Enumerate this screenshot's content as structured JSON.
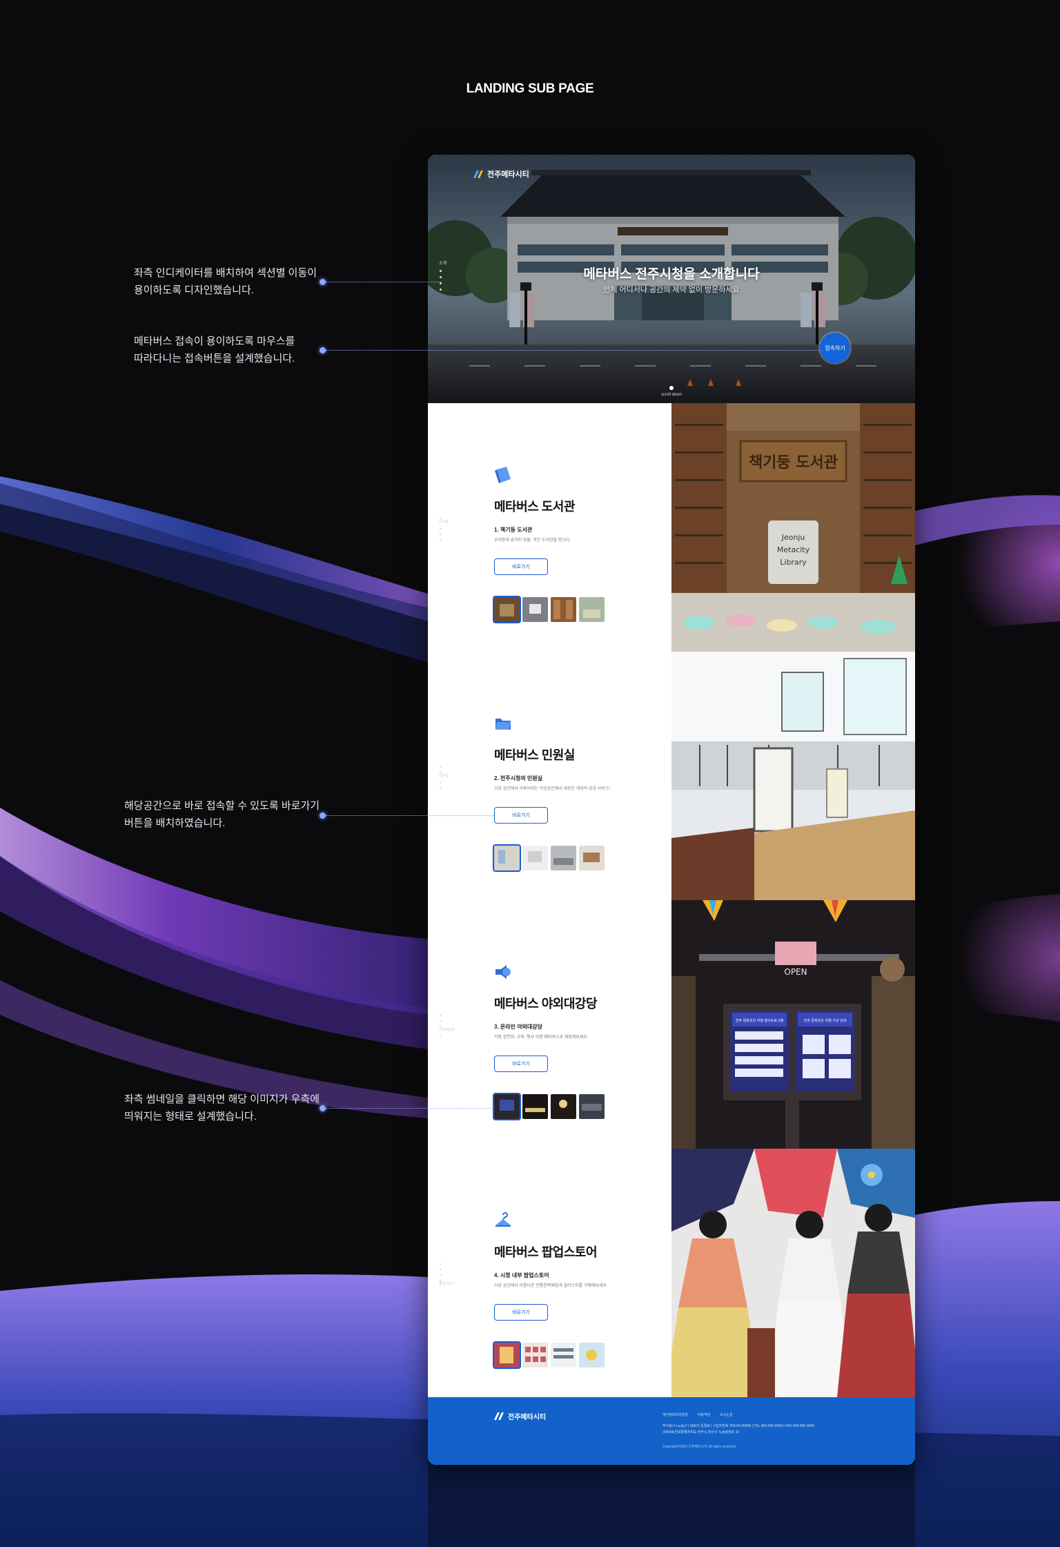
{
  "page": {
    "heading": "LANDING SUB PAGE"
  },
  "annotations": [
    {
      "lines": [
        "좌측 인디케이터를 배치하여 섹션별 이동이",
        "용이하도록 디자인했습니다."
      ]
    },
    {
      "lines": [
        "메타버스 접속이 용이하도록 마우스를",
        "따라다니는 접속버튼을 설계했습니다."
      ]
    },
    {
      "lines": [
        "해당공간으로 바로 접속할 수 있도록 바로가기",
        "버튼을 배치하였습니다."
      ]
    },
    {
      "lines": [
        "좌측 썸네일을 클릭하면 해당 이미지가 우측에",
        "띄워지는 형태로 설계했습니다."
      ]
    }
  ],
  "hero": {
    "logo": "전주메타시티",
    "title": "메타버스 전주시청을 소개합니다",
    "subtitle": "언제 어디서나 공간의 제약 없이 방문하세요",
    "indicator_label": "소개",
    "connect_label": "접속하기",
    "scroll_label": "scroll down"
  },
  "sections": [
    {
      "title": "메타버스 도서관",
      "subtitle": "1. 책기둥 도서관",
      "desc": "우리동네 숨겨진 보물, 작은 도서관을 만나다.",
      "button": "바로가기",
      "indicator_label": "도서관",
      "icon": "book-icon",
      "sign_text": "책기둥 도서관",
      "wall_text": [
        "Jeonju",
        "Metacity",
        "Library"
      ]
    },
    {
      "title": "메타버스 민원실",
      "subtitle": "2. 전주시청의 민원실",
      "desc": "가상 공간에서 이루어지는 가상공간에서 새로운 개념의 공공 서비스!",
      "button": "바로가기",
      "indicator_label": "민원실",
      "icon": "folder-icon"
    },
    {
      "title": "메타버스 야외대강당",
      "subtitle": "3. 온라인 야외대강당",
      "desc": "각종 강연회, 교육, 행사 이젠 메타버스로 체험해보세요",
      "button": "바로가기",
      "indicator_label": "야외대강당",
      "icon": "speaker-icon",
      "board_left": "전주 문화유산 야행 행사프로그램",
      "board_right": "전주 문화유산 야행 가상 안내",
      "open_sign": "OPEN"
    },
    {
      "title": "메타버스 팝업스토어",
      "subtitle": "4. 시청 내부 팝업스토어",
      "desc": "가상 공간에서 아름다운 전통한복체험과 일러스트를 구매해보세요",
      "button": "바로가기",
      "indicator_label": "팝업스토어",
      "icon": "hanger-icon"
    }
  ],
  "footer": {
    "logo": "전주메타시티",
    "links": [
      "개인정보처리방침",
      "이용약관",
      "오시는길"
    ],
    "info_lines": [
      "주식회사 Lucky7  |  대표자 김경호  |  사업자번호 000-00-00000  |  TEL 063-000-0000  |  FAX 063-000-0000",
      "(55004)전북특별자치도 전주시 완산구 노송광장로 10"
    ],
    "copyright": "Copyright©2024 전주메타시티 all rights reserved"
  },
  "colors": {
    "accent": "#1463d8",
    "footer_bg": "#1262c9",
    "annotation_dot": "#8ea8ff"
  }
}
